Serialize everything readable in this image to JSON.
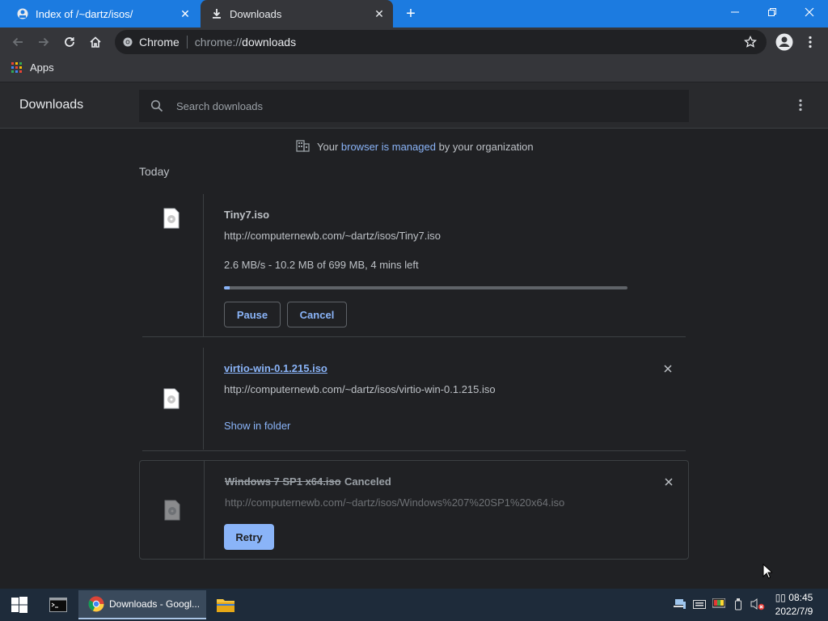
{
  "tabs": [
    {
      "title": "Index of /~dartz/isos/",
      "icon": "web-page-icon"
    },
    {
      "title": "Downloads",
      "icon": "download-icon"
    }
  ],
  "toolbar": {
    "site_name": "Chrome",
    "url_scheme": "chrome://",
    "url_path": "downloads"
  },
  "bookmarks": {
    "apps_label": "Apps"
  },
  "page": {
    "title": "Downloads",
    "search_placeholder": "Search downloads",
    "managed": {
      "prefix": "Your ",
      "link": "browser is managed",
      "suffix": " by your organization"
    },
    "section_label": "Today"
  },
  "downloads": [
    {
      "name": "Tiny7.iso",
      "url": "http://computernewb.com/~dartz/isos/Tiny7.iso",
      "status": "2.6 MB/s - 10.2 MB of 699 MB, 4 mins left",
      "progress_fraction": 0.015,
      "buttons": {
        "pause": "Pause",
        "cancel": "Cancel"
      }
    },
    {
      "name": "virtio-win-0.1.215.iso",
      "url": "http://computernewb.com/~dartz/isos/virtio-win-0.1.215.iso",
      "action": "Show in folder"
    },
    {
      "name": "Windows 7 SP1 x64.iso",
      "state": "Canceled",
      "url": "http://computernewb.com/~dartz/isos/Windows%207%20SP1%20x64.iso",
      "action": "Retry"
    }
  ],
  "taskbar": {
    "chrome_label": "Downloads - Googl...",
    "time": "08:45",
    "date": "2022/7/9",
    "clock_prefix": "▯▯"
  },
  "colors": {
    "titlebar": "#1c7be0",
    "accent": "#8ab4f8",
    "background": "#202124",
    "retry_button": "#8ab4f8"
  }
}
